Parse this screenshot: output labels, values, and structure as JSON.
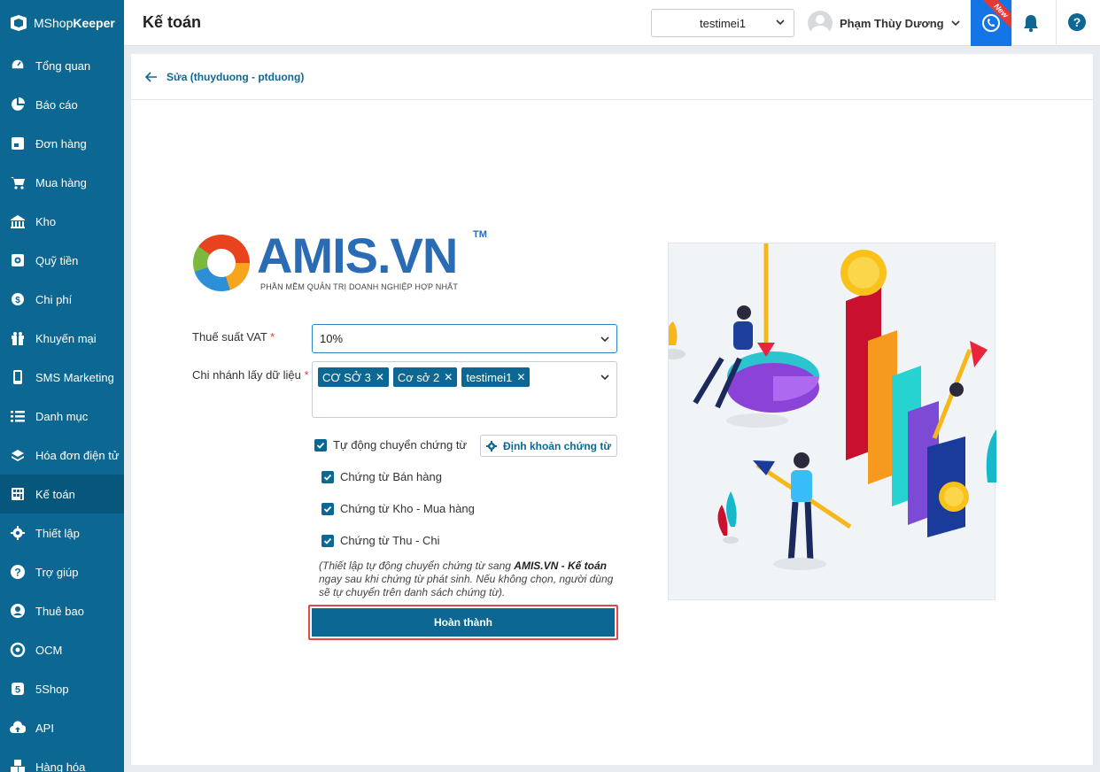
{
  "app": {
    "brand_prefix": "MShop",
    "brand_suffix": "Keeper"
  },
  "sidebar": {
    "items": [
      {
        "label": "Tổng quan",
        "icon": "dashboard-icon"
      },
      {
        "label": "Báo cáo",
        "icon": "pie-chart-icon"
      },
      {
        "label": "Đơn hàng",
        "icon": "order-icon"
      },
      {
        "label": "Mua hàng",
        "icon": "cart-icon"
      },
      {
        "label": "Kho",
        "icon": "warehouse-icon"
      },
      {
        "label": "Quỹ tiền",
        "icon": "safe-icon"
      },
      {
        "label": "Chi phí",
        "icon": "expense-icon"
      },
      {
        "label": "Khuyến mại",
        "icon": "gift-icon"
      },
      {
        "label": "SMS Marketing",
        "icon": "phone-icon"
      },
      {
        "label": "Danh mục",
        "icon": "list-icon"
      },
      {
        "label": "Hóa đơn điện tử",
        "icon": "invoice-icon"
      },
      {
        "label": "Kế toán",
        "icon": "calculator-icon",
        "active": true
      },
      {
        "label": "Thiết lập",
        "icon": "gear-icon"
      },
      {
        "label": "Trợ giúp",
        "icon": "help-icon"
      },
      {
        "label": "Thuê bao",
        "icon": "user-icon"
      },
      {
        "label": "OCM",
        "icon": "ocm-icon"
      },
      {
        "label": "5Shop",
        "icon": "shop-icon"
      },
      {
        "label": "API",
        "icon": "cloud-upload-icon"
      },
      {
        "label": "Hàng hóa",
        "icon": "boxes-icon"
      }
    ]
  },
  "header": {
    "title": "Kế toán",
    "branch": "testimei1",
    "user_name": "Phạm Thùy Dương",
    "new_badge": "New",
    "help": "?"
  },
  "page": {
    "back_title": "Sửa (thuyduong - ptduong)",
    "logo": {
      "word": "AMIS.VN",
      "tm": "TM",
      "tagline": "PHẦN MỀM QUẢN TRỊ DOANH NGHIỆP HỢP NHẤT"
    },
    "form": {
      "vat_label": "Thuế suất VAT",
      "vat_value": "10%",
      "branch_label": "Chi nhánh lấy dữ liệu",
      "required_mark": "*",
      "branch_tags": [
        "CƠ SỞ 3",
        "Cơ sở 2",
        "testimei1"
      ],
      "auto_transfer_label": "Tự động chuyển chứng từ",
      "config_button": "Định khoản chứng từ",
      "sub_checks": [
        "Chứng từ Bán hàng",
        "Chứng từ Kho - Mua hàng",
        "Chứng từ Thu - Chi"
      ],
      "note_prefix": "(Thiết lập tự động chuyển chứng từ sang ",
      "note_bold": "AMIS.VN - Kế toán",
      "note_suffix": " ngay sau khi chứng từ phát sinh. Nếu không chọn, người dùng sẽ tự chuyển trên danh sách chứng từ).",
      "submit": "Hoàn thành"
    }
  },
  "colors": {
    "sidebar": "#0c6893",
    "active": "#07567c",
    "accent": "#1475e6",
    "submit_border": "#e44747"
  }
}
